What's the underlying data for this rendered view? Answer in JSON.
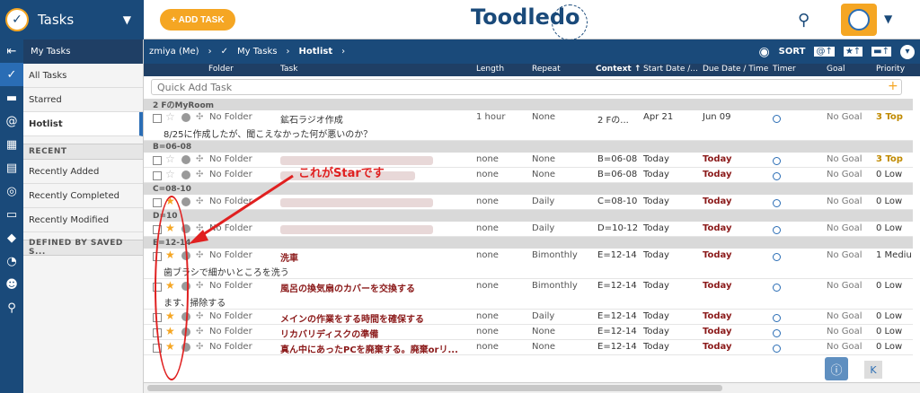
{
  "app": {
    "title": "Tasks",
    "add_task": "+ ADD TASK",
    "brand": "Toodledo"
  },
  "sidebar": {
    "head": "My Tasks",
    "items": [
      {
        "label": "All Tasks"
      },
      {
        "label": "Starred"
      },
      {
        "label": "Hotlist"
      }
    ],
    "recent_header": "RECENT",
    "recent": [
      {
        "label": "Recently Added"
      },
      {
        "label": "Recently Completed"
      },
      {
        "label": "Recently Modified"
      }
    ],
    "saved_header": "DEFINED BY SAVED S..."
  },
  "breadcrumb": {
    "user": "zmiya (Me)",
    "list": "My Tasks",
    "current": "Hotlist",
    "sort_label": "SORT"
  },
  "columns": {
    "folder": "Folder",
    "task": "Task",
    "length": "Length",
    "repeat": "Repeat",
    "context": "Context ↑",
    "start": "Start Date /...",
    "due": "Due Date / Time",
    "timer": "Timer",
    "goal": "Goal",
    "priority": "Priority"
  },
  "quickadd": {
    "placeholder": "Quick Add Task"
  },
  "groups": [
    {
      "name": "2 FのMyRoom",
      "rows": [
        {
          "starred": false,
          "folder": "No Folder",
          "task": "鉱石ラジオ作成",
          "note": "8/25に作成したが、聞こえなかった何が悪いのか？",
          "length": "1 hour",
          "repeat": "None",
          "context": "2 Fの...",
          "start": "Apr 21",
          "due": "Jun 09",
          "goal": "No Goal",
          "priority": "3 Top"
        }
      ]
    },
    {
      "name": "B=06-08",
      "rows": [
        {
          "starred": false,
          "folder": "No Folder",
          "task": "",
          "length": "none",
          "repeat": "None",
          "context": "B=06-08",
          "start": "Today",
          "due": "Today",
          "goal": "No Goal",
          "priority": "3 Top"
        },
        {
          "starred": false,
          "folder": "No Folder",
          "task": "",
          "length": "none",
          "repeat": "None",
          "context": "B=06-08",
          "start": "Today",
          "due": "Today",
          "goal": "No Goal",
          "priority": "0 Low"
        }
      ]
    },
    {
      "name": "C=08-10",
      "rows": [
        {
          "starred": true,
          "folder": "No Folder",
          "task": "",
          "length": "none",
          "repeat": "Daily",
          "context": "C=08-10",
          "start": "Today",
          "due": "Today",
          "goal": "No Goal",
          "priority": "0 Low"
        }
      ]
    },
    {
      "name": "D=10",
      "rows": [
        {
          "starred": true,
          "folder": "No Folder",
          "task": "",
          "length": "none",
          "repeat": "Daily",
          "context": "D=10-12",
          "start": "Today",
          "due": "Today",
          "goal": "No Goal",
          "priority": "0 Low"
        }
      ]
    },
    {
      "name": "E=12-14",
      "rows": [
        {
          "starred": true,
          "folder": "No Folder",
          "task": "洗車",
          "note": "歯ブラシで細かいところを洗う",
          "length": "none",
          "repeat": "Bimonthly",
          "context": "E=12-14",
          "start": "Today",
          "due": "Today",
          "goal": "No Goal",
          "priority": "1 Mediu"
        },
        {
          "starred": true,
          "folder": "No Folder",
          "task": "風呂の換気扇のカバーを交換する",
          "note": "ます、掃除する",
          "length": "none",
          "repeat": "Bimonthly",
          "context": "E=12-14",
          "start": "Today",
          "due": "Today",
          "goal": "No Goal",
          "priority": "0 Low"
        },
        {
          "starred": true,
          "folder": "No Folder",
          "task": "メインの作業をする時間を確保する",
          "length": "none",
          "repeat": "Daily",
          "context": "E=12-14",
          "start": "Today",
          "due": "Today",
          "goal": "No Goal",
          "priority": "0 Low"
        },
        {
          "starred": true,
          "folder": "No Folder",
          "task": "リカバリディスクの準備",
          "length": "none",
          "repeat": "None",
          "context": "E=12-14",
          "start": "Today",
          "due": "Today",
          "goal": "No Goal",
          "priority": "0 Low"
        },
        {
          "starred": true,
          "folder": "No Folder",
          "task": "真ん中にあったPCを廃棄する。廃棄orリ...",
          "length": "none",
          "repeat": "None",
          "context": "E=12-14",
          "start": "Today",
          "due": "Today",
          "goal": "No Goal",
          "priority": "0 Low"
        }
      ]
    }
  ],
  "annotation": {
    "text": "これがStarです",
    "color": "#e02020"
  },
  "colors": {
    "accent": "#f5a623",
    "navy": "#1a4a7a",
    "overdue": "#8b1a1a"
  }
}
